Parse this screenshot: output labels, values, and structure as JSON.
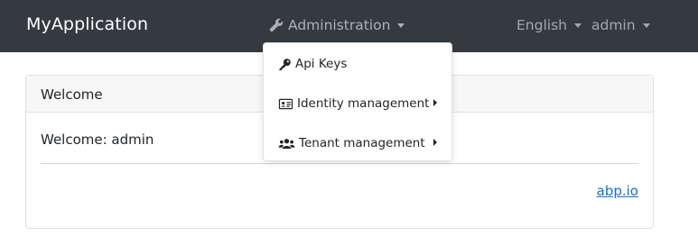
{
  "app": {
    "brand": "MyApplication"
  },
  "nav": {
    "admin_label": "Administration",
    "language_label": "English",
    "user_label": "admin"
  },
  "dropdown": {
    "items": [
      {
        "label": "Api Keys",
        "icon": "key-icon",
        "has_submenu": false
      },
      {
        "label": "Identity management",
        "icon": "id-card-icon",
        "has_submenu": true
      },
      {
        "label": "Tenant management",
        "icon": "users-icon",
        "has_submenu": true
      }
    ]
  },
  "card": {
    "header": "Welcome",
    "body_text": "Welcome: admin",
    "link_text": "abp.io"
  },
  "colors": {
    "navbar_bg": "#343a40",
    "link": "#1a6fc7"
  }
}
